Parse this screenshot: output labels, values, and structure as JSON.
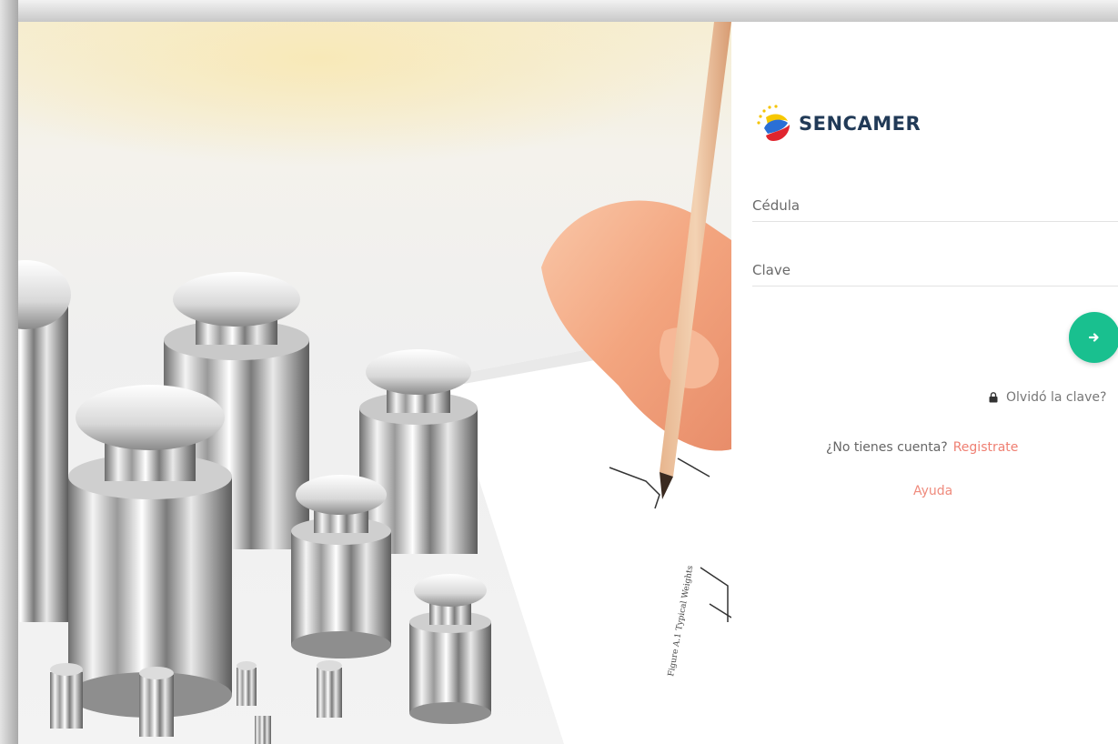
{
  "brand": {
    "name": "SENCAMER",
    "text_color": "#213a57"
  },
  "hero": {
    "description_icon": "calibration-weights-photo"
  },
  "login": {
    "cedula_placeholder": "Cédula",
    "clave_placeholder": "Clave",
    "submit_icon": "arrow-right-icon",
    "submit_color": "#19c08f",
    "forgot_label": "Olvidó la clave?",
    "forgot_icon": "lock-icon",
    "no_account_label": "¿No tienes cuenta?",
    "register_label": "Registrate",
    "help_label": "Ayuda",
    "link_color": "#ef7f72"
  }
}
